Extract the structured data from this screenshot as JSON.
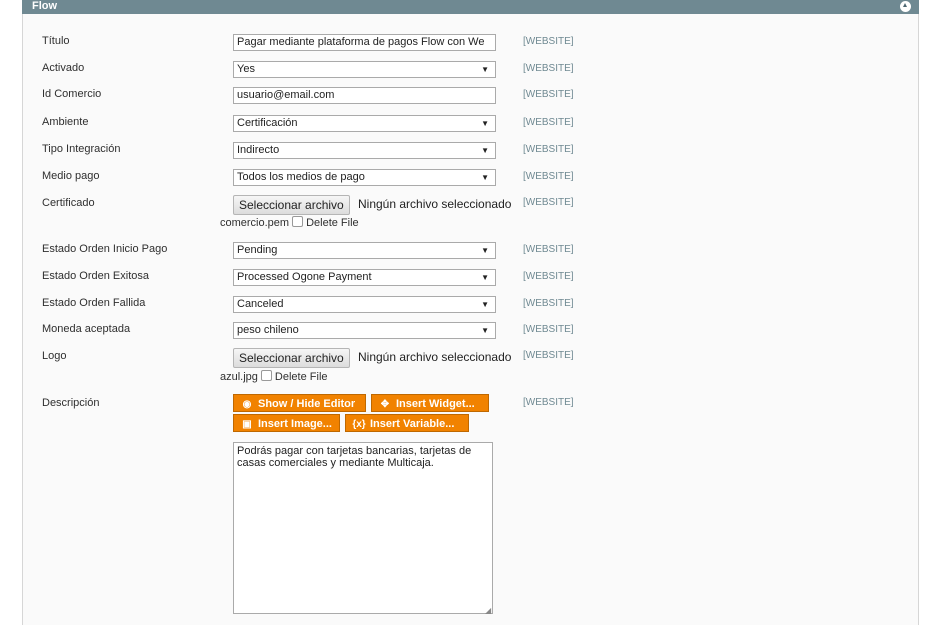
{
  "header": {
    "title": "Flow",
    "toggle_icon": "collapse-up-icon"
  },
  "scope_label": "[WEBSITE]",
  "fields": {
    "titulo": {
      "label": "Título",
      "value": "Pagar mediante plataforma de pagos Flow con We"
    },
    "activado": {
      "label": "Activado",
      "value": "Yes"
    },
    "id_comercio": {
      "label": "Id Comercio",
      "value": "usuario@email.com"
    },
    "ambiente": {
      "label": "Ambiente",
      "value": "Certificación"
    },
    "tipo_integracion": {
      "label": "Tipo Integración",
      "value": "Indirecto"
    },
    "medio_pago": {
      "label": "Medio pago",
      "value": "Todos los medios de pago"
    },
    "certificado": {
      "label": "Certificado",
      "button": "Seleccionar archivo",
      "status": "Ningún archivo seleccionado",
      "current_file": "comercio.pem",
      "delete_label": "Delete File"
    },
    "estado_inicio": {
      "label": "Estado Orden Inicio Pago",
      "value": "Pending"
    },
    "estado_exitosa": {
      "label": "Estado Orden Exitosa",
      "value": "Processed Ogone Payment"
    },
    "estado_fallida": {
      "label": "Estado Orden Fallida",
      "value": "Canceled"
    },
    "moneda": {
      "label": "Moneda aceptada",
      "value": "peso chileno"
    },
    "logo": {
      "label": "Logo",
      "button": "Seleccionar archivo",
      "status": "Ningún archivo seleccionado",
      "current_file": "azul.jpg",
      "delete_label": "Delete File"
    },
    "descripcion": {
      "label": "Descripción",
      "buttons": {
        "show_hide": "Show / Hide Editor",
        "widget": "Insert Widget...",
        "image": "Insert Image...",
        "variable": "Insert Variable..."
      },
      "value": "Podrás pagar con tarjetas bancarias, tarjetas de casas comerciales y mediante Multicaja."
    }
  }
}
